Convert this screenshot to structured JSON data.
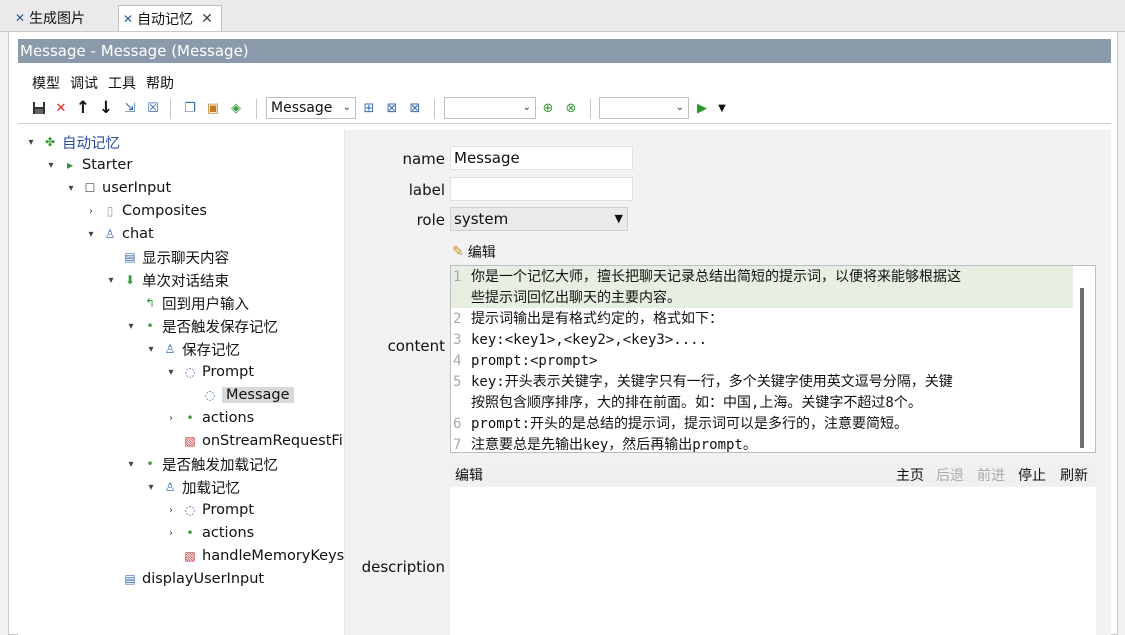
{
  "tabs": [
    {
      "label": "生成图片",
      "active": false
    },
    {
      "label": "自动记忆",
      "active": true
    }
  ],
  "window_title": "Message - Message (Message)",
  "menu": [
    "模型",
    "调试",
    "工具",
    "帮助"
  ],
  "toolbar": {
    "type_select": "Message",
    "select2": "",
    "select3": ""
  },
  "tree": [
    {
      "label": "自动记忆",
      "level": 0,
      "twisty": "▾",
      "icon": "puzzle-icon"
    },
    {
      "label": "Starter",
      "level": 1,
      "twisty": "▾",
      "icon": "starter-icon"
    },
    {
      "label": "userInput",
      "level": 2,
      "twisty": "▾",
      "icon": "checkbox-icon"
    },
    {
      "label": "Composites",
      "level": 3,
      "twisty": "›",
      "icon": "page-icon"
    },
    {
      "label": "chat",
      "level": 3,
      "twisty": "▾",
      "icon": "person-icon"
    },
    {
      "label": "显示聊天内容",
      "level": 4,
      "twisty": "",
      "icon": "display-icon"
    },
    {
      "label": "单次对话结束",
      "level": 4,
      "twisty": "▾",
      "icon": "down-arrow-icon"
    },
    {
      "label": "回到用户输入",
      "level": 5,
      "twisty": "",
      "icon": "return-icon"
    },
    {
      "label": "是否触发保存记忆",
      "level": 5,
      "twisty": "▾",
      "icon": "dot-icon"
    },
    {
      "label": "保存记忆",
      "level": 6,
      "twisty": "▾",
      "icon": "person-icon"
    },
    {
      "label": "Prompt",
      "level": 7,
      "twisty": "▾",
      "icon": "chat-icon"
    },
    {
      "label": "Message",
      "level": 8,
      "twisty": "",
      "icon": "chat-icon",
      "selected": true
    },
    {
      "label": "actions",
      "level": 7,
      "twisty": "›",
      "icon": "dot-icon"
    },
    {
      "label": "onStreamRequestFi",
      "level": 7,
      "twisty": "",
      "icon": "script-icon"
    },
    {
      "label": "是否触发加载记忆",
      "level": 5,
      "twisty": "▾",
      "icon": "dot-icon"
    },
    {
      "label": "加载记忆",
      "level": 6,
      "twisty": "▾",
      "icon": "person-icon"
    },
    {
      "label": "Prompt",
      "level": 7,
      "twisty": "›",
      "icon": "chat-icon"
    },
    {
      "label": "actions",
      "level": 7,
      "twisty": "›",
      "icon": "dot-icon"
    },
    {
      "label": "handleMemoryKeys",
      "level": 7,
      "twisty": "",
      "icon": "script-icon"
    },
    {
      "label": "displayUserInput",
      "level": 4,
      "twisty": "",
      "icon": "display-icon"
    }
  ],
  "props": {
    "name_label": "name",
    "name_value": "Message",
    "label_label": "label",
    "label_value": "",
    "role_label": "role",
    "role_value": "system",
    "edit_label": "编辑",
    "content_label": "content",
    "description_label": "description"
  },
  "content_lines": [
    {
      "n": "1",
      "text": "你是一个记忆大师，擅长把聊天记录总结出简短的提示词，以便将来能够根据这"
    },
    {
      "n": "",
      "text": "些提示词回忆出聊天的主要内容。"
    },
    {
      "n": "2",
      "text": "提示词输出是有格式约定的，格式如下："
    },
    {
      "n": "3",
      "text": "key:<key1>,<key2>,<key3>...."
    },
    {
      "n": "4",
      "text": "prompt:<prompt>"
    },
    {
      "n": "5",
      "text": "key:开头表示关键字，关键字只有一行，多个关键字使用英文逗号分隔，关键"
    },
    {
      "n": "",
      "text": "按照包含顺序排序，大的排在前面。如：中国,上海。关键字不超过8个。"
    },
    {
      "n": "6",
      "text": "prompt:开头的是总结的提示词，提示词可以是多行的，注意要简短。"
    },
    {
      "n": "7",
      "text": "注意要总是先输出key，然后再输出prompt。"
    }
  ],
  "description_toolbar": {
    "left": "编辑",
    "home": "主页",
    "back": "后退",
    "forward": "前进",
    "stop": "停止",
    "refresh": "刷新"
  }
}
